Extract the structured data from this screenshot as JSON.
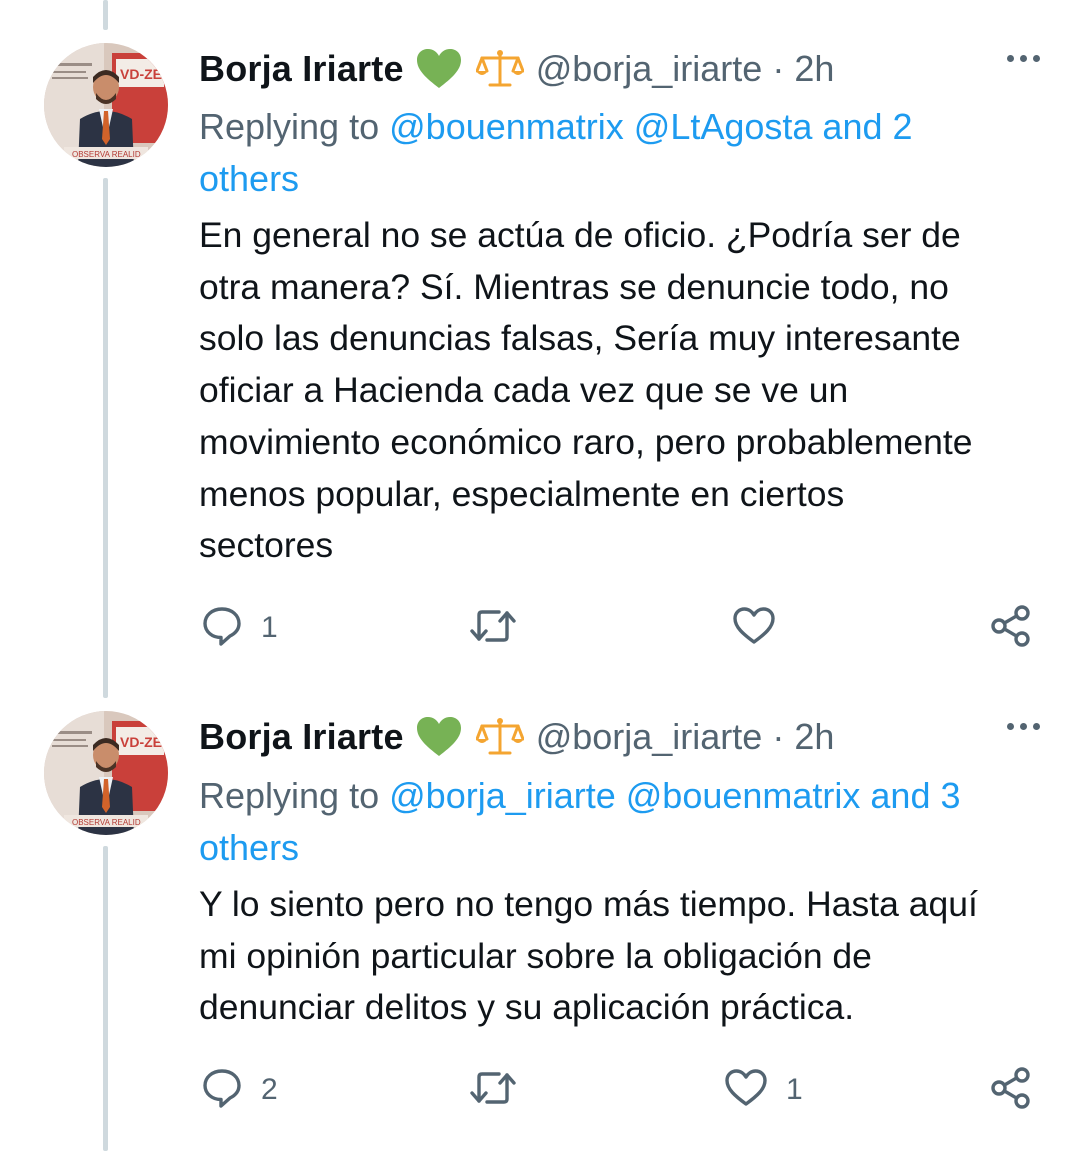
{
  "tweets": [
    {
      "author": {
        "name": "Borja Iriarte",
        "handle": "@borja_iriarte",
        "emoji": [
          "green-heart",
          "balance-scale"
        ]
      },
      "separator": "·",
      "time": "2h",
      "replying_prefix": "Replying to",
      "replying_line1_links": "@bouenmatrix @LtAgosta and 2",
      "replying_line2_link": "others",
      "body_lines": [
        "En general no se actúa de oficio. ¿Podría ser de",
        "otra manera? Sí. Mientras se denuncie todo, no",
        "solo las denuncias falsas, Sería muy interesante",
        "oficiar a Hacienda cada vez que se ve un",
        "movimiento económico raro, pero probablemente",
        "menos popular, especialmente en ciertos",
        "sectores"
      ],
      "actions": {
        "reply_count": "1",
        "retweet_count": "",
        "like_count": ""
      }
    },
    {
      "author": {
        "name": "Borja Iriarte",
        "handle": "@borja_iriarte",
        "emoji": [
          "green-heart",
          "balance-scale"
        ]
      },
      "separator": "·",
      "time": "2h",
      "replying_prefix": "Replying to",
      "replying_line1_links": "@borja_iriarte @bouenmatrix and 3",
      "replying_line2_link": "others",
      "body_lines": [
        "Y lo siento pero no tengo más tiempo. Hasta aquí",
        "mi opinión particular sobre la obligación de",
        "denunciar delitos y su aplicación práctica."
      ],
      "actions": {
        "reply_count": "2",
        "retweet_count": "",
        "like_count": "1"
      }
    }
  ],
  "colors": {
    "text": "#0f1419",
    "secondary": "#536471",
    "link": "#1d9bf0",
    "thread_line": "#cfd9de",
    "green_heart": "#77b255",
    "scales": "#f4a531"
  },
  "icons": {
    "reply": "reply-bubble-icon",
    "retweet": "retweet-arrows-icon",
    "like": "heart-outline-icon",
    "share": "share-nodes-icon",
    "more": "more-dots-icon"
  }
}
